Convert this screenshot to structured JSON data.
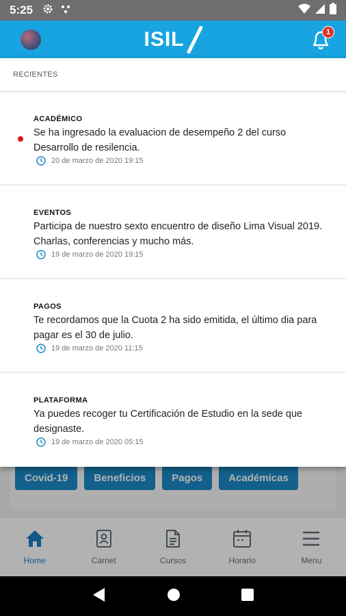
{
  "status_bar": {
    "time": "5:25"
  },
  "header": {
    "logo_text": "ISIL",
    "notification_count": "1"
  },
  "panel": {
    "title": "RECIENTES",
    "notifications": [
      {
        "category": "ACADÉMICO",
        "text": "Se ha ingresado la evaluacion de desempeño 2 del curso Desarrollo de resilencia.",
        "time": "20 de marzo de 2020 19:15",
        "unread": true
      },
      {
        "category": "EVENTOS",
        "text": "Participa de nuestro sexto encuentro de diseño Lima Visual 2019. Charlas, conferencias y mucho más.",
        "time": "19 de marzo de 2020 19:15",
        "unread": false
      },
      {
        "category": "PAGOS",
        "text": "Te recordamos que la Cuota 2 ha sido emitida, el último dia para pagar es el 30 de julio.",
        "time": "19 de marzo de 2020 11:15",
        "unread": false
      },
      {
        "category": "PLATAFORMA",
        "text": "Ya puedes recoger tu Certificación de Estudio en la sede que designaste.",
        "time": "19 de marzo de 2020 05:15",
        "unread": false
      }
    ]
  },
  "chips": [
    "Covid-19",
    "Beneficios",
    "Pagos",
    "Académicas"
  ],
  "bottom_nav": [
    {
      "label": "Home",
      "icon": "home-icon",
      "active": true
    },
    {
      "label": "Carnet",
      "icon": "id-card-icon",
      "active": false
    },
    {
      "label": "Cursos",
      "icon": "document-icon",
      "active": false
    },
    {
      "label": "Horario",
      "icon": "calendar-icon",
      "active": false
    },
    {
      "label": "Menu",
      "icon": "hamburger-icon",
      "active": false
    }
  ],
  "colors": {
    "brand": "#17a4e0",
    "chip": "#1b8ac7",
    "active_nav": "#1b7fc4",
    "unread": "#e3151a"
  }
}
